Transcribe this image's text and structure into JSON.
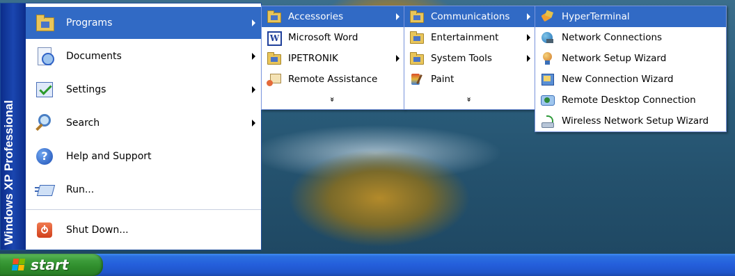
{
  "start_menu": {
    "side_text_brand": "Windows XP",
    "side_text_edition": "Professional",
    "items": [
      {
        "label": "Programs",
        "icon": "programs-folder-icon",
        "has_submenu": true,
        "highlighted": true
      },
      {
        "label": "Documents",
        "icon": "documents-icon",
        "has_submenu": true
      },
      {
        "label": "Settings",
        "icon": "settings-icon",
        "has_submenu": true
      },
      {
        "label": "Search",
        "icon": "search-icon",
        "has_submenu": true
      },
      {
        "label": "Help and Support",
        "icon": "help-icon"
      },
      {
        "label": "Run...",
        "icon": "run-icon"
      },
      {
        "label": "Shut Down...",
        "icon": "shutdown-icon"
      }
    ]
  },
  "programs_menu": {
    "items": [
      {
        "label": "Accessories",
        "icon": "folder-icon",
        "has_submenu": true,
        "highlighted": true
      },
      {
        "label": "Microsoft Word",
        "icon": "word-icon"
      },
      {
        "label": "IPETRONIK",
        "icon": "folder-icon",
        "has_submenu": true
      },
      {
        "label": "Remote Assistance",
        "icon": "remote-assistance-icon"
      }
    ],
    "more": "»"
  },
  "accessories_menu": {
    "items": [
      {
        "label": "Communications",
        "icon": "folder-icon",
        "has_submenu": true,
        "highlighted": true
      },
      {
        "label": "Entertainment",
        "icon": "folder-icon",
        "has_submenu": true
      },
      {
        "label": "System Tools",
        "icon": "folder-icon",
        "has_submenu": true
      },
      {
        "label": "Paint",
        "icon": "paint-icon"
      }
    ],
    "more": "»"
  },
  "communications_menu": {
    "items": [
      {
        "label": "HyperTerminal",
        "icon": "hyperterminal-icon",
        "highlighted": true
      },
      {
        "label": "Network Connections",
        "icon": "network-connections-icon"
      },
      {
        "label": "Network Setup Wizard",
        "icon": "network-setup-icon"
      },
      {
        "label": "New Connection Wizard",
        "icon": "new-connection-icon"
      },
      {
        "label": "Remote Desktop Connection",
        "icon": "remote-desktop-icon"
      },
      {
        "label": "Wireless Network Setup Wizard",
        "icon": "wireless-icon"
      }
    ]
  },
  "taskbar": {
    "start_label": "start"
  },
  "colors": {
    "highlight": "#316ac5",
    "side_strip": "#1a46b0",
    "taskbar": "#245edb",
    "start_button": "#2f8d2c"
  }
}
